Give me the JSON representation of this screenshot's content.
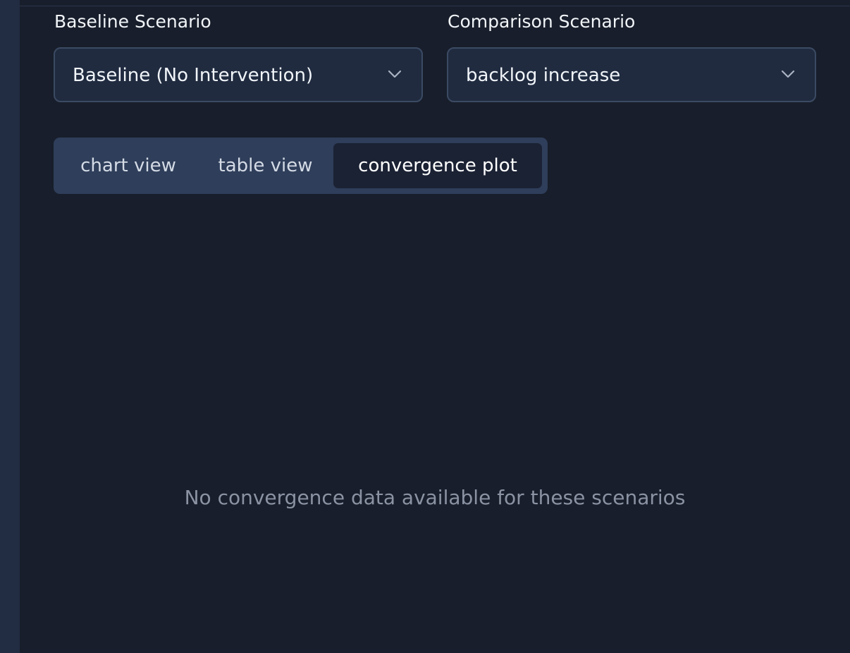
{
  "baseline": {
    "label": "Baseline Scenario",
    "selected": "Baseline (No Intervention)",
    "icon": "chevron-down-icon"
  },
  "comparison": {
    "label": "Comparison Scenario",
    "selected": "backlog increase",
    "icon": "chevron-down-icon"
  },
  "tabs": [
    {
      "label": "chart view",
      "active": false
    },
    {
      "label": "table view",
      "active": false
    },
    {
      "label": "convergence plot",
      "active": true
    }
  ],
  "empty_state": {
    "message": "No convergence data available for these scenarios"
  },
  "colors": {
    "background": "#181e2b",
    "panel": "#202b40",
    "tab_bar": "#2f3e5a",
    "tab_active": "#1b2234",
    "muted_text": "#8b93a3"
  }
}
